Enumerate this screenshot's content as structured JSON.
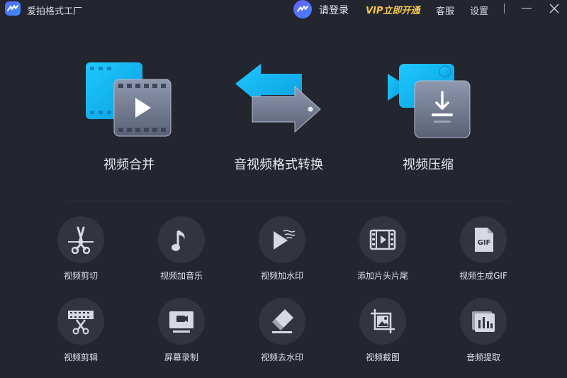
{
  "app": {
    "title": "爱拍格式工厂",
    "logo_icon": "app-logo-icon"
  },
  "titlebar": {
    "login_label": "请登录",
    "vip_label": "VIP立即开通",
    "service_label": "客服",
    "settings_label": "设置"
  },
  "colors": {
    "background": "#23252f",
    "tool_circle": "#32353f",
    "accent_blue": "#14b4f0",
    "vip_gold": "#f3c84b"
  },
  "main_features": [
    {
      "label": "视频合并",
      "icon": "video-merge-icon"
    },
    {
      "label": "音视频格式转换",
      "icon": "format-convert-icon"
    },
    {
      "label": "视频压缩",
      "icon": "video-compress-icon"
    }
  ],
  "tools": [
    {
      "label": "视频剪切",
      "icon": "scissors-icon"
    },
    {
      "label": "视频加音乐",
      "icon": "music-note-icon"
    },
    {
      "label": "视频加水印",
      "icon": "watermark-play-icon"
    },
    {
      "label": "添加片头片尾",
      "icon": "film-strip-icon"
    },
    {
      "label": "视频生成GIF",
      "icon": "gif-file-icon",
      "badge": "GIF"
    },
    {
      "label": "视频剪辑",
      "icon": "film-scissors-icon"
    },
    {
      "label": "屏幕录制",
      "icon": "screen-record-icon"
    },
    {
      "label": "视频去水印",
      "icon": "eraser-icon"
    },
    {
      "label": "视频截图",
      "icon": "image-crop-icon"
    },
    {
      "label": "音频提取",
      "icon": "audio-wave-icon"
    }
  ]
}
